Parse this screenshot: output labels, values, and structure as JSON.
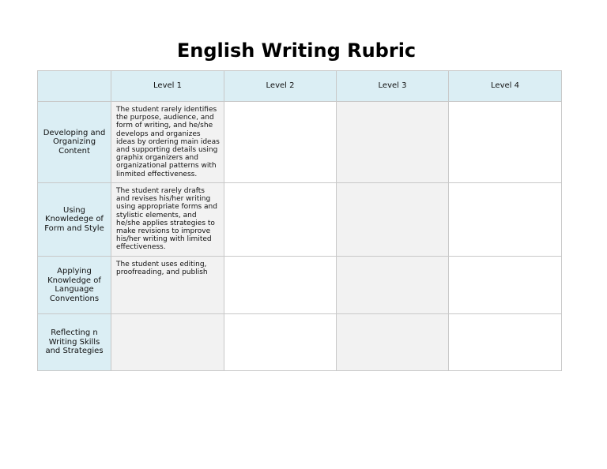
{
  "title": "English Writing Rubric",
  "columns": [
    "",
    "Level 1",
    "Level 2",
    "Level 3",
    "Level 4"
  ],
  "rows": [
    {
      "criterion": "Developing and Organizing Content",
      "level1": "The student rarely identifies the purpose, audience, and form of writing, and he/she develops and organizes ideas by ordering main ideas and supporting details using graphix organizers and organizational patterns with linmited effectiveness.",
      "level2": "",
      "level3": "",
      "level4": ""
    },
    {
      "criterion": "Using Knowledege of Form and Style",
      "level1": "The student rarely drafts and revises his/her writing using appropriate forms and stylistic elements, and he/she applies strategies to make revisions to improve his/her writing with limited effectiveness.",
      "level2": "",
      "level3": "",
      "level4": ""
    },
    {
      "criterion": "Applying Knowledge of Language Conventions",
      "level1": "The student uses editing, proofreading, and publish",
      "level2": "",
      "level3": "",
      "level4": ""
    },
    {
      "criterion": "Reflecting n Writing Skills and Strategies",
      "level1": "",
      "level2": "",
      "level3": "",
      "level4": ""
    }
  ]
}
